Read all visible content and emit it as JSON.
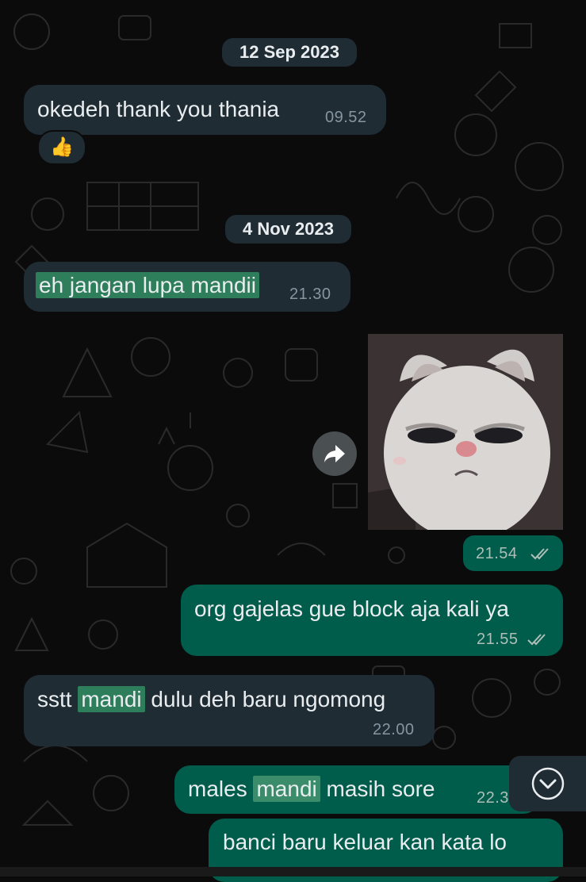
{
  "dates": {
    "first": "12 Sep 2023",
    "second": "4 Nov 2023"
  },
  "messages": [
    {
      "direction": "in",
      "text": "okedeh thank you thania",
      "time": "09.52",
      "reaction": "👍"
    },
    {
      "direction": "in",
      "text_highlight": "eh jangan lupa mandii",
      "time": "21.30"
    },
    {
      "direction": "out",
      "type": "image",
      "image_desc": "grumpy white bunny sticker",
      "time": "21.54",
      "status": "read"
    },
    {
      "direction": "out",
      "text": "org gajelas gue block aja kali ya",
      "time": "21.55",
      "status": "read"
    },
    {
      "direction": "in",
      "text_before": "sstt",
      "text_highlight": "mandi",
      "text_after": "dulu deh baru ngomong",
      "time": "22.00"
    },
    {
      "direction": "out",
      "text_before": "males",
      "text_highlight": "mandi",
      "text_after": "masih sore",
      "time": "22.3"
    },
    {
      "direction": "out",
      "text": "banci baru keluar kan kata lo"
    }
  ],
  "icons": {
    "forward": "forward-arrow-icon",
    "scroll_down": "chevron-down-circle-icon",
    "read_ticks": "double-check-icon"
  },
  "colors": {
    "background": "#0b0b0b",
    "incoming_bubble": "#1f2c34",
    "outgoing_bubble": "#005c4b",
    "highlight": "#2e7d5b"
  }
}
